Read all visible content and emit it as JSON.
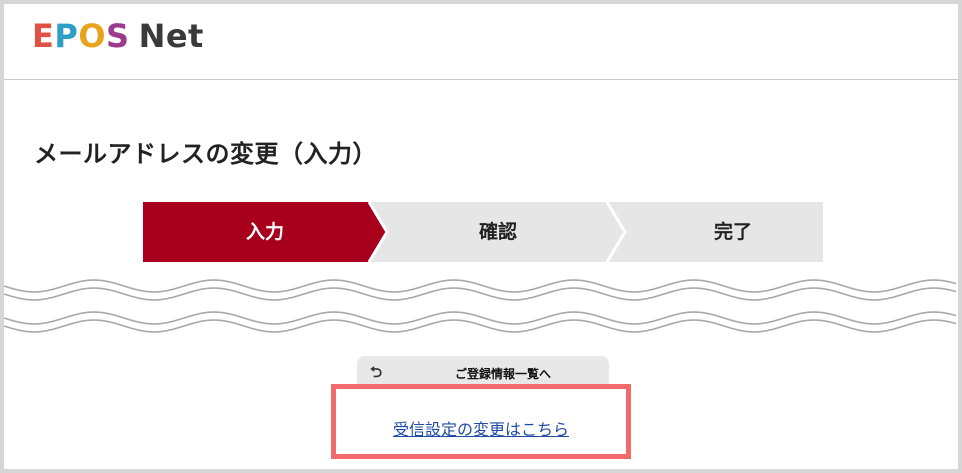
{
  "header": {
    "logo_letters": [
      {
        "char": "E",
        "color": "#e05246"
      },
      {
        "char": "P",
        "color": "#2e9ec4"
      },
      {
        "char": "O",
        "color": "#e8a21c"
      },
      {
        "char": "S",
        "color": "#9b3b8c"
      }
    ],
    "logo_net": "Net"
  },
  "main": {
    "title": "メールアドレスの変更（入力）",
    "steps": [
      {
        "label": "入力",
        "active": true
      },
      {
        "label": "確認",
        "active": false
      },
      {
        "label": "完了",
        "active": false
      }
    ],
    "colors": {
      "step_active": "#a8001c",
      "step_inactive": "#e6e6e6",
      "highlight_border": "#f26a6a",
      "link": "#1f4ba8"
    },
    "back_button": {
      "icon": "return-arrow-icon",
      "label": "ご登録情報一覧へ"
    },
    "link_text": "受信設定の変更はこちら"
  }
}
